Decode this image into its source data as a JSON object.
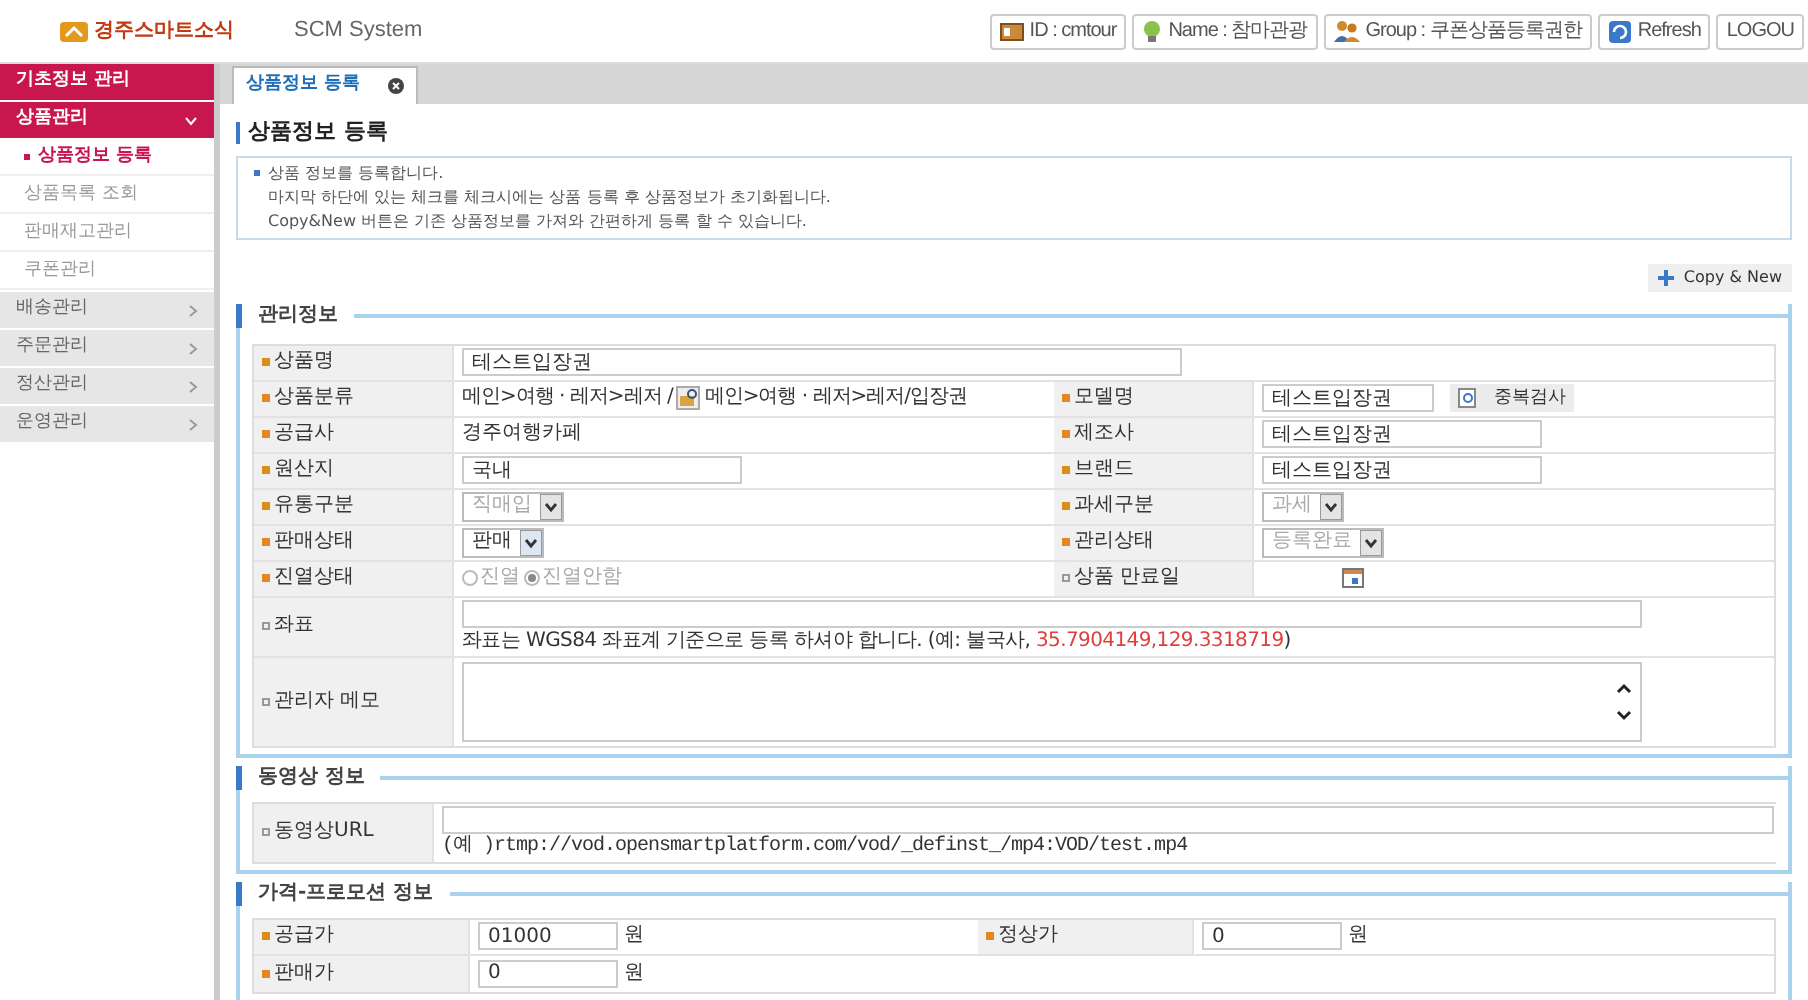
{
  "header": {
    "logo": "경주스마트소식",
    "title": "SCM System",
    "buttons": [
      {
        "kind": "user",
        "label": "ID : cmtour"
      },
      {
        "kind": "name",
        "label": "Name : 참마관광"
      },
      {
        "kind": "group",
        "label": "Group : 쿠폰상품등록권한"
      },
      {
        "kind": "refresh",
        "label": "Refresh"
      },
      {
        "kind": "logout",
        "label": "LOGOU"
      }
    ]
  },
  "sidebar": [
    {
      "label": "기초정보 관리",
      "kind": "top",
      "expanded": false
    },
    {
      "label": "상품관리",
      "kind": "top",
      "expanded": true,
      "children": [
        {
          "label": "상품정보 등록",
          "selected": true
        },
        {
          "label": "상품목록 조회",
          "selected": false
        },
        {
          "label": "판매재고관리",
          "selected": false
        },
        {
          "label": "쿠폰관리",
          "selected": false
        }
      ]
    },
    {
      "label": "배송관리",
      "kind": "menu",
      "expanded": false
    },
    {
      "label": "주문관리",
      "kind": "menu",
      "expanded": false
    },
    {
      "label": "정산관리",
      "kind": "menu",
      "expanded": false
    },
    {
      "label": "운영관리",
      "kind": "menu",
      "expanded": false
    }
  ],
  "tabs": [
    {
      "label": "상품정보 등록",
      "selected": true
    }
  ],
  "page_title": "상품정보 등록",
  "info": [
    "상품 정보를 등록합니다.",
    "마지막 하단에 있는 체크를 체크시에는 상품 등록 후 상품정보가 초기화됩니다.",
    "Copy&New 버튼은 기존 상품정보를 가져와 간편하게 등록 할 수 있습니다."
  ],
  "copy_button": "Copy & New",
  "sections": [
    {
      "legend": "관리정보",
      "rows": [
        [
          {
            "label": "상품명",
            "required": true,
            "kind": "input",
            "value": "테스트입장권"
          }
        ],
        [
          {
            "label": "상품분류",
            "required": true,
            "kind": "category",
            "parts": [
              "메인>여행 · 레저>레저 /",
              "메인>여행 · 레저>레저/입장권"
            ]
          },
          {
            "label": "모델명",
            "required": true,
            "kind": "model",
            "value": "테스트입장권",
            "button": "중복검사"
          }
        ],
        [
          {
            "label": "공급사",
            "required": true,
            "kind": "text",
            "value": "경주여행카페"
          },
          {
            "label": "제조사",
            "required": true,
            "kind": "input",
            "value": "테스트입장권"
          }
        ],
        [
          {
            "label": "원산지",
            "required": true,
            "kind": "input",
            "value": "국내"
          },
          {
            "label": "브랜드",
            "required": true,
            "kind": "input",
            "value": "테스트입장권"
          }
        ],
        [
          {
            "label": "유통구분",
            "required": true,
            "kind": "select",
            "value": "직매입",
            "disabled": true
          },
          {
            "label": "과세구분",
            "required": true,
            "kind": "select",
            "value": "과세",
            "disabled": true
          }
        ],
        [
          {
            "label": "판매상태",
            "required": true,
            "kind": "select",
            "value": "판매",
            "disabled": false
          },
          {
            "label": "관리상태",
            "required": true,
            "kind": "select",
            "value": "등록완료",
            "disabled": true
          }
        ],
        [
          {
            "label": "진열상태",
            "required": true,
            "kind": "radio",
            "disabled": true,
            "options": [
              {
                "label": "진열",
                "selected": false
              },
              {
                "label": "진열안함",
                "selected": true
              }
            ]
          },
          {
            "label": "상품 만료일",
            "required": false,
            "kind": "date"
          }
        ],
        [
          {
            "label": "좌표",
            "required": false,
            "kind": "coords",
            "note": "좌표는 WGS84 좌표계 기준으로 등록 하셔야 합니다. (예: 불국사, ",
            "example": "35.7904149,129.3318719",
            "note_end": ")"
          }
        ],
        [
          {
            "label": "관리자 메모",
            "required": false,
            "kind": "textarea"
          }
        ]
      ]
    },
    {
      "legend": "동영상 정보",
      "rows": [
        [
          {
            "label": "동영상URL",
            "required": false,
            "kind": "url",
            "hint": "(예 )rtmp://vod.opensmartplatform.com/vod/_definst_/mp4:VOD/test.mp4"
          }
        ]
      ]
    },
    {
      "legend": "가격-프로모션 정보",
      "rows": [
        [
          {
            "label": "공급가",
            "required": true,
            "kind": "price",
            "value": "01000",
            "unit": "원"
          },
          {
            "label": "정상가",
            "required": true,
            "kind": "price",
            "value": "0",
            "unit": "원"
          }
        ],
        [
          {
            "label": "판매가",
            "required": true,
            "kind": "price",
            "value": "0",
            "unit": "원"
          }
        ]
      ]
    }
  ]
}
